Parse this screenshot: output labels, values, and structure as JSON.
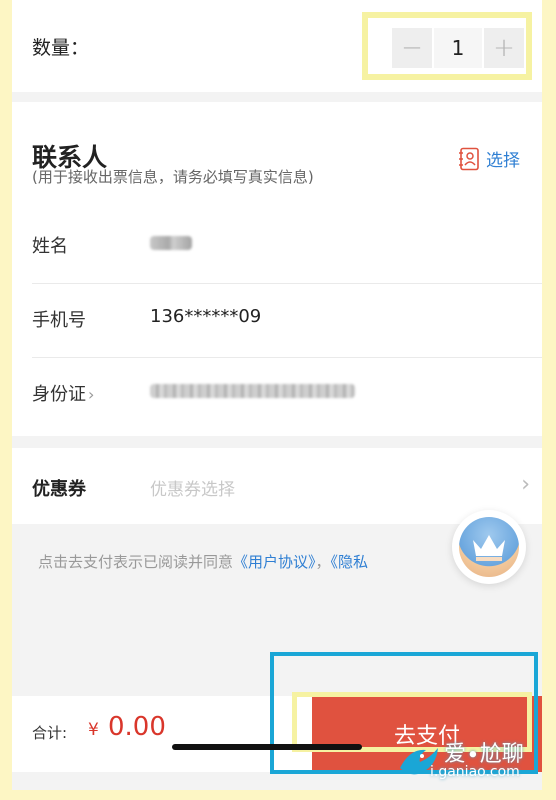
{
  "quantity": {
    "label": "数量：",
    "minus": "−",
    "value": "1",
    "plus": "+"
  },
  "contact": {
    "title": "联系人",
    "subtitle": "(用于接收出票信息，请务必填写真实信息)",
    "select_label": "选择",
    "fields": [
      {
        "label": "姓名",
        "value": ""
      },
      {
        "label": "手机号",
        "value": "136******09"
      },
      {
        "label": "身份证",
        "value": ""
      }
    ],
    "id_chevron": "›"
  },
  "coupon": {
    "label": "优惠券",
    "placeholder": "优惠券选择",
    "chevron": "›"
  },
  "agreement": {
    "prefix": "点击去支付表示已阅读并同意",
    "link1": "《用户协议》",
    "sep": "，",
    "link2": "《隐私"
  },
  "bottom": {
    "total_label": "合计:",
    "currency": "¥",
    "total_value": "0.00",
    "pay_label": "去支付"
  },
  "watermark": {
    "line1": "爱∙尬聊",
    "line2": "i.ganiao.com"
  },
  "colors": {
    "accent_red": "#e0523f",
    "link_blue": "#2f7fd3",
    "highlight_yellow": "#f6f2a2",
    "highlight_blue": "#1aa6d6"
  }
}
